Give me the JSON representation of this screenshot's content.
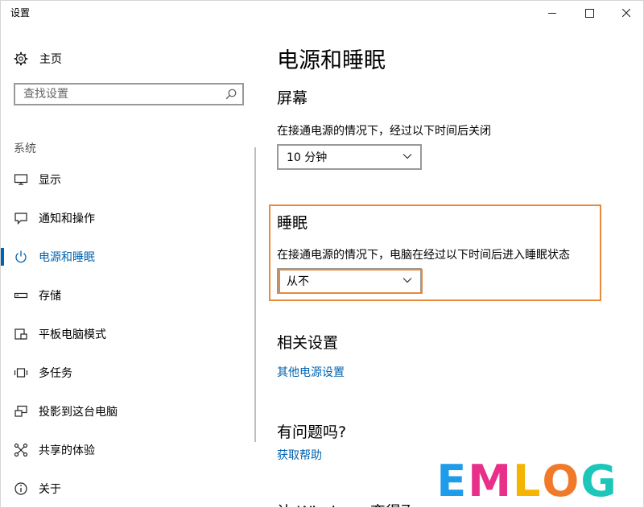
{
  "window": {
    "title": "设置"
  },
  "sidebar": {
    "home_label": "主页",
    "search_placeholder": "查找设置",
    "section_label": "系统",
    "items": [
      {
        "label": "显示",
        "icon": "monitor-icon",
        "active": false
      },
      {
        "label": "通知和操作",
        "icon": "message-icon",
        "active": false
      },
      {
        "label": "电源和睡眠",
        "icon": "power-icon",
        "active": true
      },
      {
        "label": "存储",
        "icon": "storage-drive-icon",
        "active": false
      },
      {
        "label": "平板电脑模式",
        "icon": "tablet-mode-icon",
        "active": false
      },
      {
        "label": "多任务",
        "icon": "multitask-icon",
        "active": false
      },
      {
        "label": "投影到这台电脑",
        "icon": "project-icon",
        "active": false
      },
      {
        "label": "共享的体验",
        "icon": "share-icon",
        "active": false
      },
      {
        "label": "关于",
        "icon": "info-icon",
        "active": false
      }
    ]
  },
  "main": {
    "title": "电源和睡眠",
    "screen": {
      "heading": "屏幕",
      "description": "在接通电源的情况下，经过以下时间后关闭",
      "value": "10 分钟"
    },
    "sleep": {
      "heading": "睡眠",
      "description": "在接通电源的情况下，电脑在经过以下时间后进入睡眠状态",
      "value": "从不"
    },
    "related": {
      "heading": "相关设置",
      "link": "其他电源设置"
    },
    "help": {
      "heading": "有问题吗?",
      "link": "获取帮助"
    },
    "partial_heading": "让 Windows 变得更好"
  },
  "watermark": {
    "letters": [
      "E",
      "M",
      "L",
      "O",
      "G"
    ],
    "colors": [
      "#1e9be9",
      "#e8308a",
      "#f5b400",
      "#f07a2a",
      "#1cc6b9"
    ]
  },
  "colors": {
    "accent": "#0063b1",
    "highlight": "#e98a3b"
  }
}
